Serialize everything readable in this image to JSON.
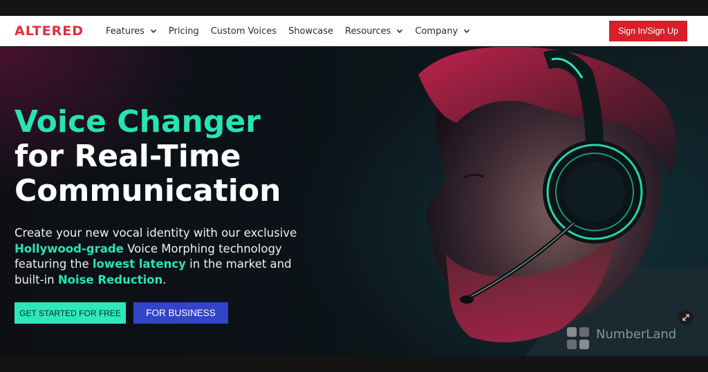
{
  "brand": {
    "logo_text": "ALTERED",
    "accent": "#e0303a"
  },
  "nav": {
    "items": [
      {
        "label": "Features",
        "has_dropdown": true
      },
      {
        "label": "Pricing",
        "has_dropdown": false
      },
      {
        "label": "Custom Voices",
        "has_dropdown": false
      },
      {
        "label": "Showcase",
        "has_dropdown": false
      },
      {
        "label": "Resources",
        "has_dropdown": true
      },
      {
        "label": "Company",
        "has_dropdown": true
      }
    ],
    "signin_label": "Sign In/Sign Up"
  },
  "hero": {
    "title_line1": "Voice Changer",
    "title_line2": "for Real-Time",
    "title_line3": "Communication",
    "desc_part1": "Create your new vocal identity with our exclusive ",
    "desc_hl1": "Hollywood-grade",
    "desc_part2": " Voice Morphing technology featuring the ",
    "desc_hl2": "lowest latency",
    "desc_part3": " in the market and built-in ",
    "desc_hl3": "Noise Reduction",
    "desc_part4": ".",
    "cta_primary": "GET STARTED FOR FREE",
    "cta_secondary": "FOR BUSINESS",
    "highlight_color": "#27e3b6"
  },
  "watermark": {
    "text": "NumberLand"
  },
  "icons": [
    "chevron-down-icon",
    "expand-icon",
    "watermark-logo-icon"
  ]
}
